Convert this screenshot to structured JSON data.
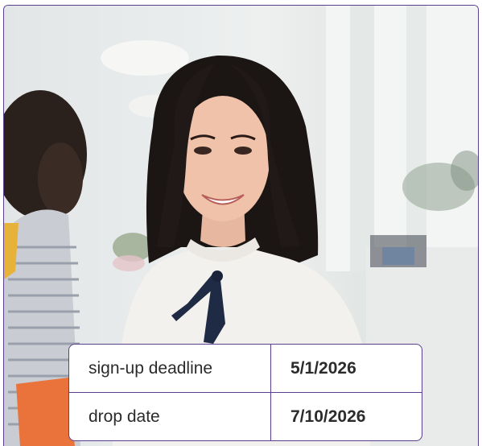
{
  "photo": {
    "icon": "photo-woman-smiling"
  },
  "details": [
    {
      "label": "sign-up deadline",
      "value": "5/1/2026"
    },
    {
      "label": "drop date",
      "value": "7/10/2026"
    }
  ],
  "colors": {
    "border": "#5a3f8f",
    "text": "#2b2b2b"
  }
}
